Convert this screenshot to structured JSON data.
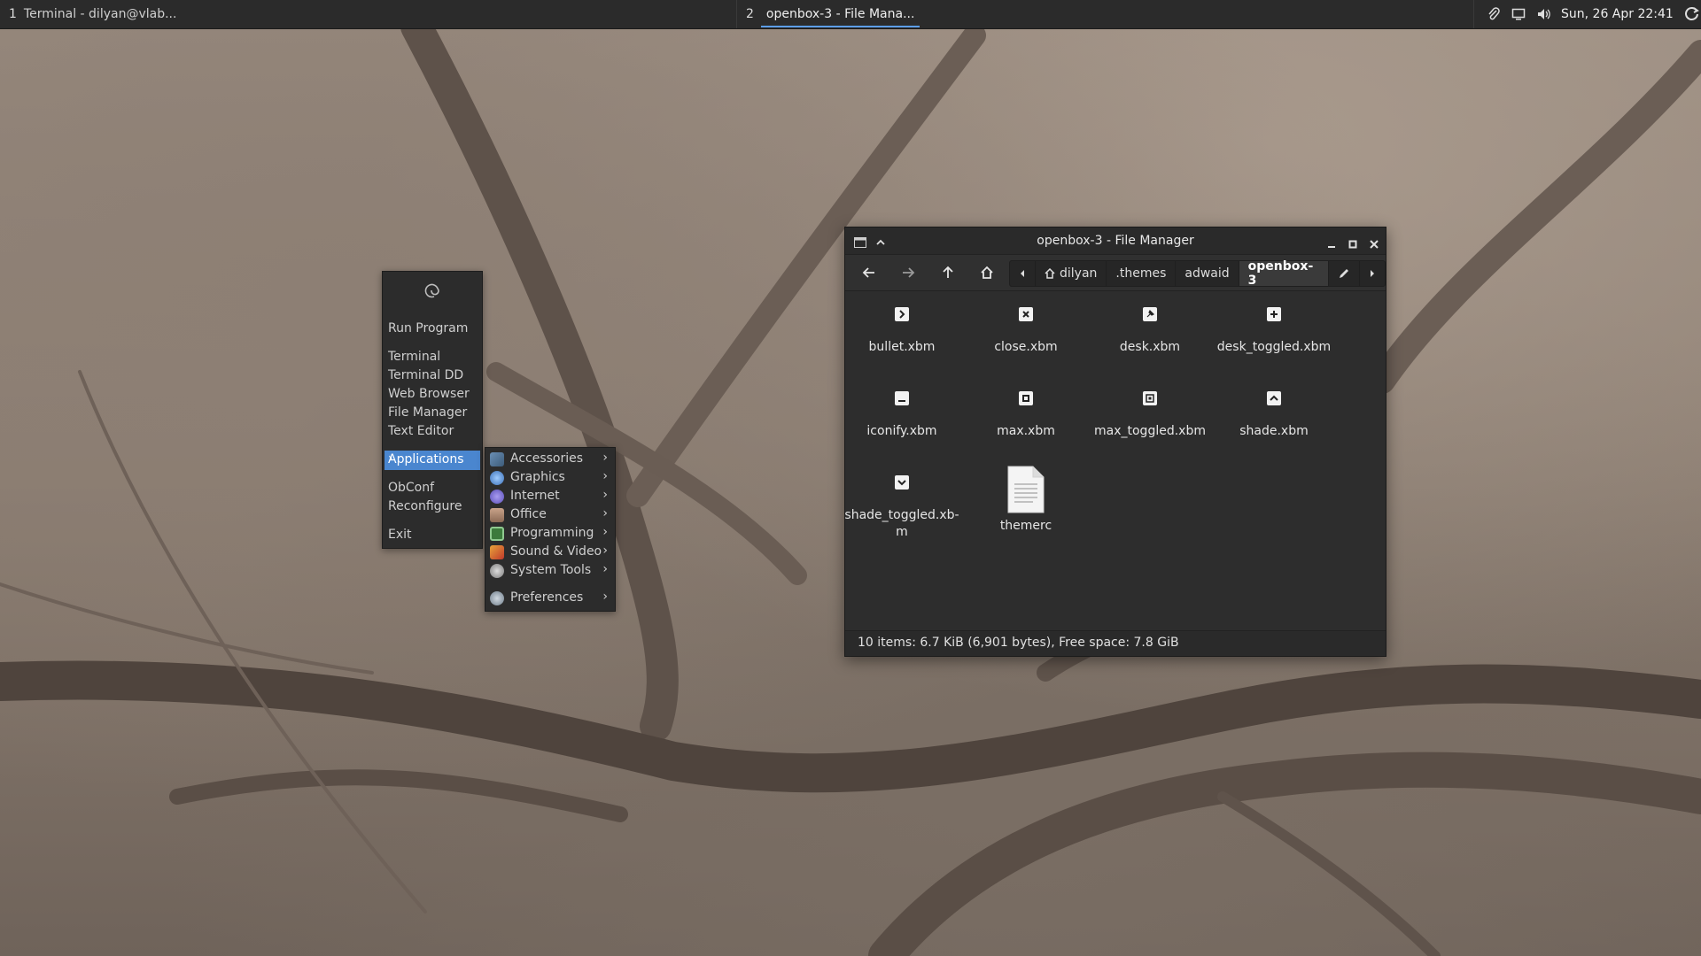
{
  "panel": {
    "tasks": [
      {
        "num": "1",
        "label": "Terminal - dilyan@vlab..."
      },
      {
        "num": "2",
        "label": "openbox-3 - File Mana..."
      }
    ],
    "tray_icons": [
      "paperclip-icon",
      "display-icon",
      "volume-icon"
    ],
    "clock": "Sun, 26 Apr 22:41",
    "end_icon": "power-icon"
  },
  "root_menu": {
    "logo_icon": "debian-swirl-icon",
    "items": {
      "run_program": "Run Program",
      "terminal": "Terminal",
      "terminal_dd": "Terminal DD",
      "web_browser": "Web Browser",
      "file_manager": "File Manager",
      "text_editor": "Text Editor",
      "applications": "Applications",
      "obconf": "ObConf",
      "reconfigure": "Reconfigure",
      "exit": "Exit"
    },
    "highlight_color": "#4a86cf"
  },
  "applications_menu": {
    "items": [
      {
        "label": "Accessories",
        "icon": "accessories-icon"
      },
      {
        "label": "Graphics",
        "icon": "graphics-icon"
      },
      {
        "label": "Internet",
        "icon": "internet-icon"
      },
      {
        "label": "Office",
        "icon": "office-icon"
      },
      {
        "label": "Programming",
        "icon": "programming-icon"
      },
      {
        "label": "Sound & Video",
        "icon": "sound-video-icon"
      },
      {
        "label": "System Tools",
        "icon": "system-tools-icon"
      },
      {
        "label": "Preferences",
        "icon": "preferences-icon"
      }
    ]
  },
  "file_manager": {
    "title": "openbox-3 - File Manager",
    "breadcrumbs": [
      "dilyan",
      ".themes",
      "adwaid",
      "openbox-3"
    ],
    "files": [
      {
        "name": "bullet.xbm",
        "icon": "bullet-icon"
      },
      {
        "name": "close.xbm",
        "icon": "close-icon"
      },
      {
        "name": "desk.xbm",
        "icon": "pin-icon"
      },
      {
        "name": "desk_toggled.xbm",
        "icon": "plus-icon"
      },
      {
        "name": "iconify.xbm",
        "icon": "minimize-icon"
      },
      {
        "name": "max.xbm",
        "icon": "maximize-icon"
      },
      {
        "name": "max_toggled.xbm",
        "icon": "restore-icon"
      },
      {
        "name": "shade.xbm",
        "icon": "chevron-up-icon"
      },
      {
        "name": "shade_toggled.xb-\nm",
        "icon": "chevron-down-icon"
      },
      {
        "name": "themerc",
        "icon": "text-document-icon"
      }
    ],
    "status": "10 items: 6.7 KiB (6,901 bytes), Free space: 7.8 GiB"
  }
}
